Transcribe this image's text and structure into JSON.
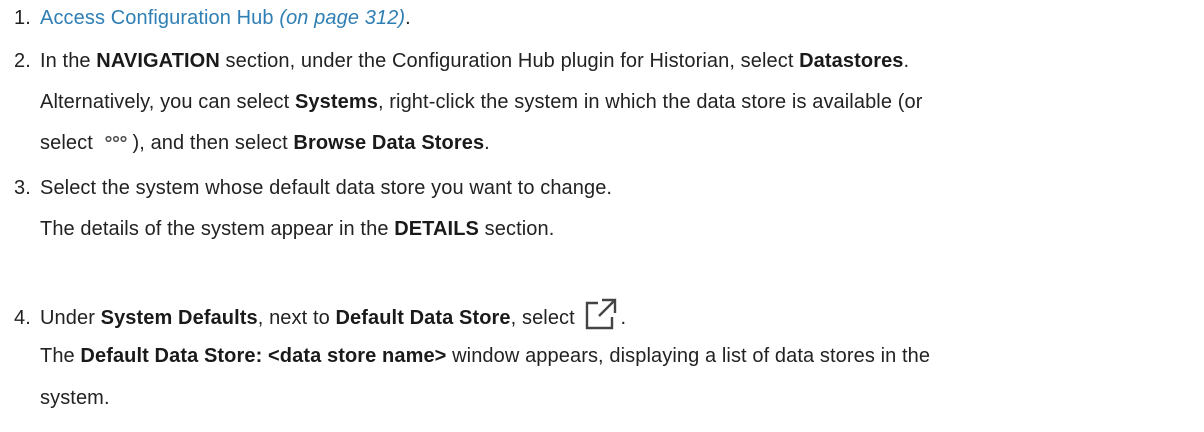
{
  "steps": [
    {
      "number": "1.",
      "link_text": "Access Configuration Hub",
      "page_ref": "(on page 312)",
      "end": "."
    },
    {
      "number": "2.",
      "line1": {
        "a": "In the ",
        "b1": "NAVIGATION",
        "c": " section, under the Configuration Hub plugin for Historian, select ",
        "b2": "Datastores",
        "d": "."
      },
      "line2": {
        "a": "Alternatively, you can select ",
        "b1": "Systems",
        "c": ", right-click the system in which the data store is available (or"
      },
      "line3": {
        "a": "select ",
        "icon": "more-options-icon",
        "c": "), and then select ",
        "b1": "Browse Data Stores",
        "d": "."
      }
    },
    {
      "number": "3.",
      "line1": "Select the system whose default data store you want to change.",
      "line2": {
        "a": "The details of the system appear in the ",
        "b1": "DETAILS",
        "c": " section."
      }
    },
    {
      "number": "4.",
      "line1": {
        "a": "Under ",
        "b1": "System Defaults",
        "c": ", next to ",
        "b2": "Default Data Store",
        "d": ", select ",
        "icon": "launch-icon",
        "e": "."
      },
      "line2": {
        "a": "The ",
        "b1": "Default Data Store: <data store name>",
        "c": " window appears, displaying a list of data stores in the"
      },
      "line3": "system."
    }
  ],
  "colors": {
    "text": "#222222",
    "link": "#2f7fb4"
  }
}
